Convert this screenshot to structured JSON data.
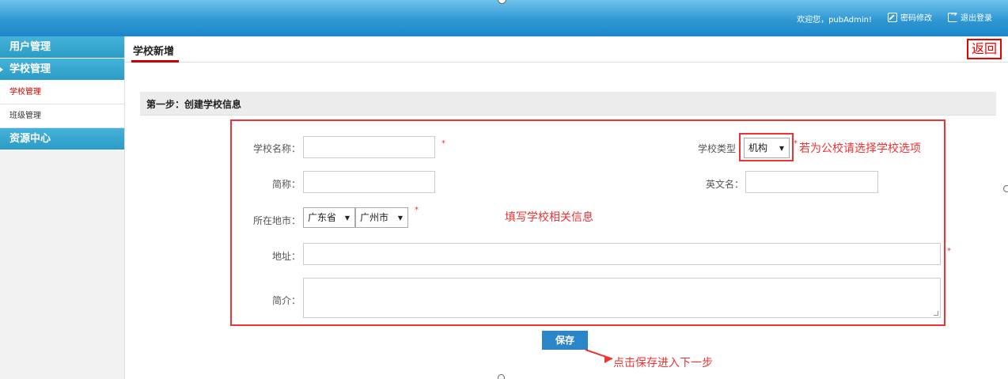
{
  "header": {
    "welcome": "欢迎您，pubAdmin!",
    "password_link": "密码修改",
    "logout_link": "退出登录"
  },
  "sidebar": {
    "groups": [
      {
        "label": "用户管理"
      },
      {
        "label": "学校管理",
        "items": [
          {
            "label": "学校管理"
          },
          {
            "label": "班级管理"
          }
        ]
      },
      {
        "label": "资源中心"
      }
    ]
  },
  "main": {
    "tab": "学校新增",
    "back": "返回",
    "step_title": "第一步：创建学校信息"
  },
  "form": {
    "school_name_label": "学校名称：",
    "short_name_label": "简称：",
    "location_label": "所在地市：",
    "address_label": "地址：",
    "intro_label": "简介：",
    "school_type_label": "学校类型",
    "english_name_label": "英文名：",
    "school_type_value": "机构",
    "province_value": "广东省",
    "city_value": "广州市",
    "required_mark": "*",
    "save_label": "保存"
  },
  "annotations": {
    "school_type_note": "若为公校请选择学校选项",
    "fill_info": "填写学校相关信息",
    "save_note": "点击保存进入下一步"
  }
}
